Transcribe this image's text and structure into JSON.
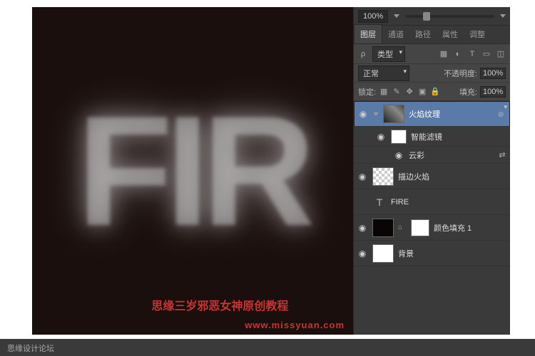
{
  "zoom": "100%",
  "tabs": {
    "layers": "图层",
    "channels": "通道",
    "paths": "路径",
    "properties": "属性",
    "adjustments": "调整"
  },
  "filter": {
    "label": "类型"
  },
  "blend": {
    "mode": "正常",
    "opacityLabel": "不透明度:",
    "opacity": "100%"
  },
  "lock": {
    "label": "锁定:",
    "fillLabel": "填充:",
    "fill": "100%"
  },
  "layers": {
    "l1": "火焰纹理",
    "l2": "智能滤镜",
    "l3": "云彩",
    "l4": "描边火焰",
    "l5": "FIRE",
    "l6": "颜色填充 1",
    "l7": "背景"
  },
  "canvas_text": "FIR",
  "watermark_main": "思缘三岁邪恶女神原创教程",
  "watermark_url": "www.missyuan.com",
  "footer": "思缘设计论坛"
}
